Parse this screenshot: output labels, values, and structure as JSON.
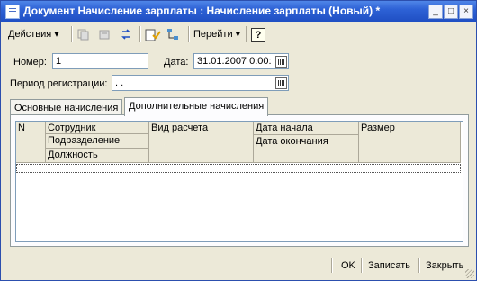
{
  "window": {
    "title": "Документ Начисление зарплаты : Начисление зарплаты (Новый) *"
  },
  "title_buttons": {
    "minimize": "_",
    "maximize": "□",
    "close": "×"
  },
  "toolbar": {
    "actions_label": "Действия ▾",
    "goto_label": "Перейти ▾",
    "help_label": "?"
  },
  "form": {
    "number_label": "Номер:",
    "number_value": "1",
    "date_label": "Дата:",
    "date_value": "31.01.2007  0:00:",
    "period_label": "Период регистрации:",
    "period_value": " .  ."
  },
  "tabs": [
    {
      "label": "Основные начисления"
    },
    {
      "label": "Дополнительные начисления"
    }
  ],
  "grid": {
    "headers": {
      "n": "N",
      "employee": "Сотрудник",
      "department": "Подразделение",
      "position": "Должность",
      "calc_type": "Вид расчета",
      "start_date": "Дата начала",
      "end_date": "Дата окончания",
      "amount": "Размер"
    }
  },
  "footer": {
    "ok_label": "OK",
    "save_label": "Записать",
    "close_label": "Закрыть"
  },
  "colors": {
    "titlebar": "#2e62d6",
    "window_bg": "#ece9d8",
    "border": "#7f9db9"
  }
}
